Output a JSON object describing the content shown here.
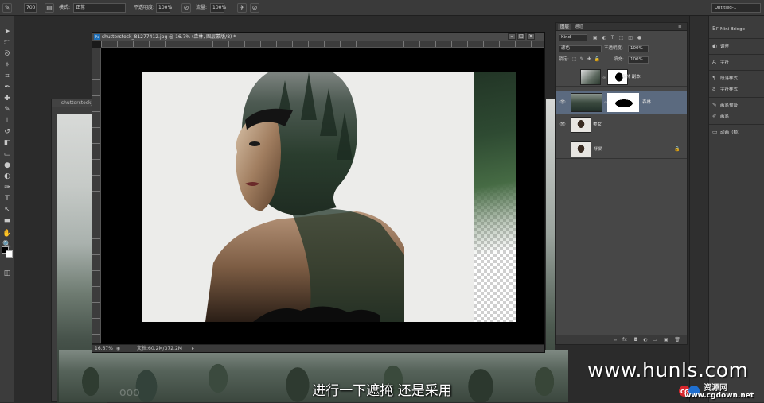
{
  "options_bar": {
    "brush_size": "700",
    "mode_label": "模式:",
    "mode_value": "正常",
    "opacity_label": "不透明度:",
    "opacity_value": "100%",
    "flow_label": "流量:",
    "flow_value": "100%",
    "workspace": "Untitled-1"
  },
  "doc_back": {
    "title": "shutterstock_1"
  },
  "document": {
    "title": "shutterstock_81277412.jpg @ 16.7% (森林, 图层蒙版/8) *",
    "zoom": "16.67%",
    "doc_size": "文档:60.2M/372.2M"
  },
  "layers_panel": {
    "tabs": [
      "图层",
      "通道"
    ],
    "filter_kind": "Kind",
    "blend_mode": "滤色",
    "opacity_label": "不透明度:",
    "opacity_value": "100%",
    "lock_label": "锁定:",
    "fill_label": "填充:",
    "fill_value": "100%",
    "layers": [
      {
        "name": "森林 副本",
        "visible": false,
        "selected": false
      },
      {
        "name": "森林",
        "visible": true,
        "selected": true
      },
      {
        "name": "美女",
        "visible": true,
        "selected": false
      },
      {
        "name": "背景",
        "visible": false,
        "selected": false,
        "locked": true
      }
    ]
  },
  "right_panel": {
    "items": [
      "Mini Bridge",
      "调整",
      "字符",
      "段落样式",
      "字符样式",
      "画笔预设",
      "画笔",
      "动画（帧）"
    ]
  },
  "subtitle": "进行一下遮掩 还是采用",
  "watermark": "www.hunls.com",
  "logo": {
    "text": "资源网",
    "url": "www.cgdown.net"
  },
  "ghost_text": "ooo"
}
